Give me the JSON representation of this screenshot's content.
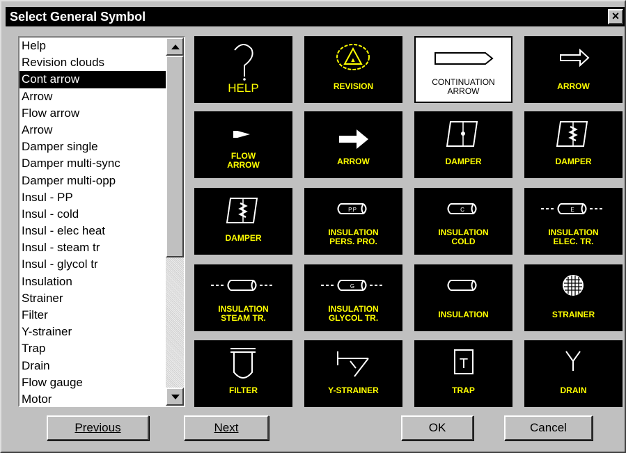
{
  "dialog": {
    "title": "Select General Symbol",
    "close_label": "×"
  },
  "list": {
    "items": [
      "Help",
      "Revision clouds",
      "Cont arrow",
      "Arrow",
      "Flow arrow",
      "Arrow",
      "Damper single",
      "Damper multi-sync",
      "Damper multi-opp",
      "Insul - PP",
      "Insul - cold",
      "Insul - elec heat",
      "Insul - steam tr",
      "Insul - glycol tr",
      "Insulation",
      "Strainer",
      "Filter",
      "Y-strainer",
      "Trap",
      "Drain",
      "Flow gauge",
      "Motor"
    ],
    "selected_index": 2
  },
  "tiles": [
    {
      "label": "HELP",
      "icon": "question-mark-icon"
    },
    {
      "label": "REVISION",
      "icon": "revision-cloud-icon"
    },
    {
      "label": "CONTINUATION\nARROW",
      "icon": "continuation-arrow-icon",
      "selected": true
    },
    {
      "label": "ARROW",
      "icon": "outline-arrow-icon"
    },
    {
      "label": "FLOW\nARROW",
      "icon": "flow-arrow-icon"
    },
    {
      "label": "ARROW",
      "icon": "solid-arrow-icon"
    },
    {
      "label": "DAMPER",
      "icon": "damper-single-icon"
    },
    {
      "label": "DAMPER",
      "icon": "damper-multi-icon"
    },
    {
      "label": "DAMPER",
      "icon": "damper-opp-icon"
    },
    {
      "label": "INSULATION\nPERS. PRO.",
      "icon": "insulation-pp-icon",
      "tag": "P.P"
    },
    {
      "label": "INSULATION\nCOLD",
      "icon": "insulation-cold-icon",
      "tag": "C"
    },
    {
      "label": "INSULATION\nELEC. TR.",
      "icon": "insulation-elec-icon",
      "tag": "E"
    },
    {
      "label": "INSULATION\nSTEAM TR.",
      "icon": "insulation-steam-icon"
    },
    {
      "label": "INSULATION\nGLYCOL TR.",
      "icon": "insulation-glycol-icon",
      "tag": "G"
    },
    {
      "label": "INSULATION",
      "icon": "insulation-icon"
    },
    {
      "label": "STRAINER",
      "icon": "strainer-icon"
    },
    {
      "label": "FILTER",
      "icon": "filter-icon"
    },
    {
      "label": "Y-STRAINER",
      "icon": "y-strainer-icon"
    },
    {
      "label": "TRAP",
      "icon": "trap-icon",
      "tag": "T"
    },
    {
      "label": "DRAIN",
      "icon": "drain-icon"
    }
  ],
  "buttons": {
    "previous": "Previous",
    "next": "Next",
    "ok": "OK",
    "cancel": "Cancel"
  },
  "colors": {
    "tile_bg": "#000000",
    "tile_label": "#ffff00",
    "selection": "#000000",
    "dialog_bg": "#c0c0c0"
  }
}
